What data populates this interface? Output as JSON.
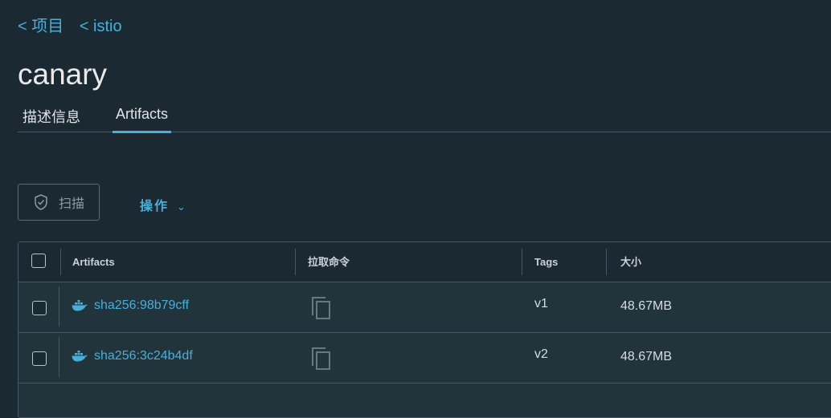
{
  "breadcrumb": {
    "projects": "< 项目",
    "repo": "< istio"
  },
  "page": {
    "title": "canary"
  },
  "tabs": [
    {
      "label": "描述信息"
    },
    {
      "label": "Artifacts"
    }
  ],
  "toolbar": {
    "scan_label": "扫描",
    "actions_label": "操作"
  },
  "table": {
    "headers": {
      "artifacts": "Artifacts",
      "pull_command": "拉取命令",
      "tags": "Tags",
      "size": "大小"
    },
    "rows": [
      {
        "digest": "sha256:98b79cff",
        "tag": "v1",
        "size": "48.67MB"
      },
      {
        "digest": "sha256:3c24b4df",
        "tag": "v2",
        "size": "48.67MB"
      }
    ]
  },
  "icons": {
    "artifact": "docker-whale-icon",
    "copy": "copy-icon",
    "scan": "shield-check-icon",
    "dropdown": "chevron-down-icon"
  },
  "colors": {
    "background": "#1b2a32",
    "accent": "#49afd9",
    "border": "#485764"
  }
}
